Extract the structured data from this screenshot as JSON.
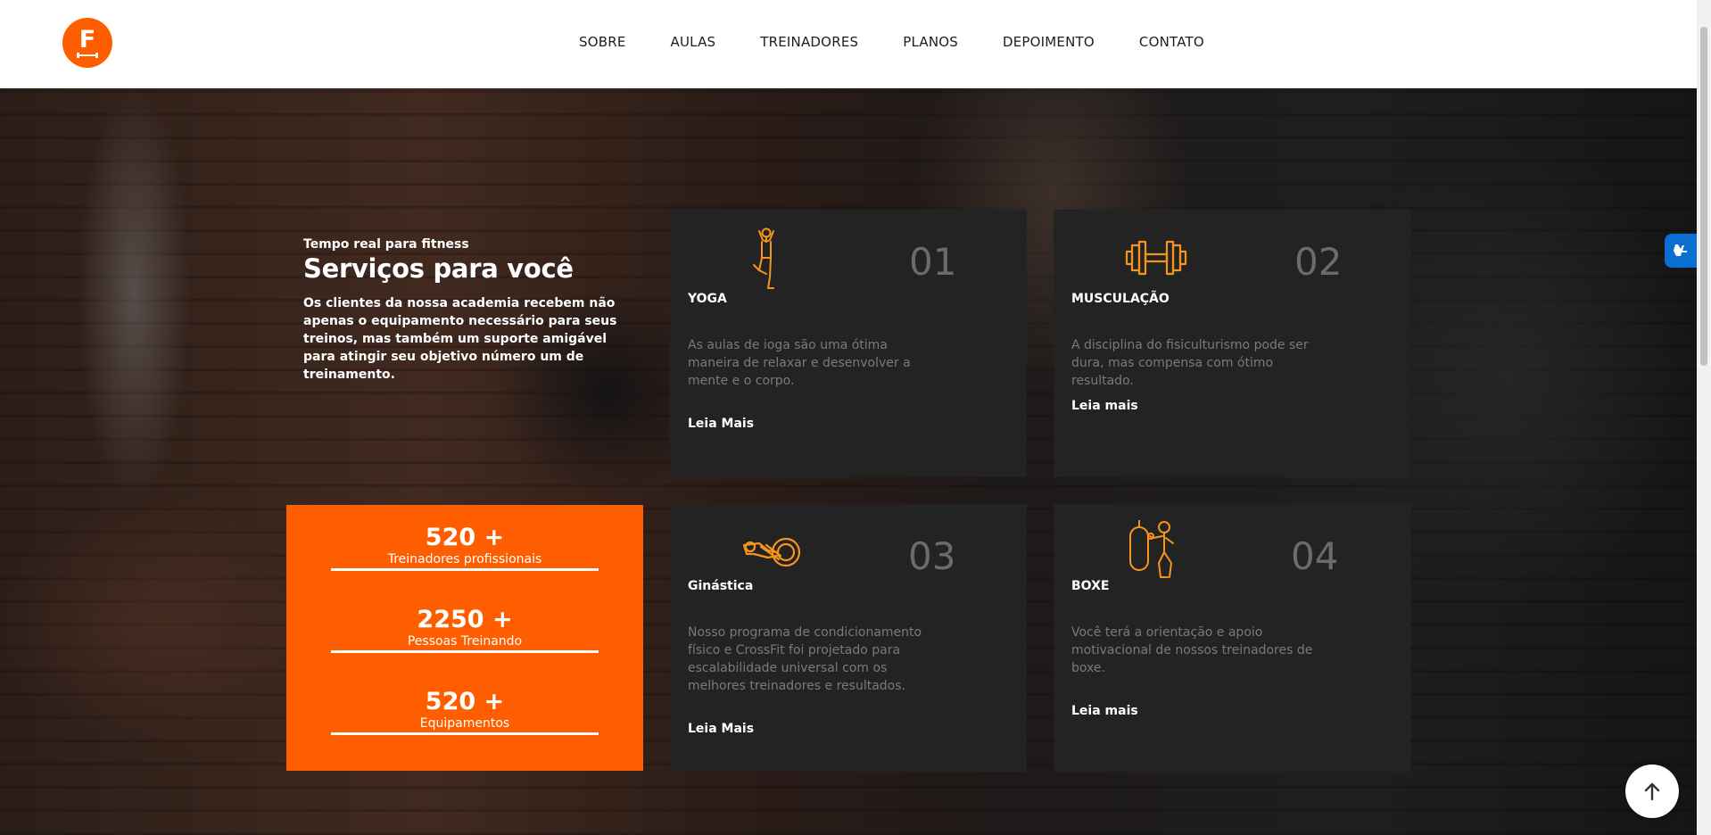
{
  "brand": {
    "logo_letter": "F",
    "accent": "#ff5e00"
  },
  "nav": {
    "items": [
      "SOBRE",
      "AULAS",
      "TREINADORES",
      "PLANOS",
      "DEPOIMENTO",
      "CONTATO"
    ]
  },
  "intro": {
    "kicker": "Tempo real para fitness",
    "title": "Serviços para você",
    "text": "Os clientes da nossa academia recebem não apenas o equipamento necessário para seus treinos, mas também um suporte amigável para atingir seu objetivo número um de treinamento."
  },
  "stats": [
    {
      "value": "520 +",
      "label": "Treinadores profissionais"
    },
    {
      "value": "2250 +",
      "label": "Pessoas Treinando"
    },
    {
      "value": "520 +",
      "label": "Equipamentos"
    }
  ],
  "services": [
    {
      "number": "01",
      "title": "YOGA",
      "icon": "yoga-icon",
      "description": "As aulas de ioga são uma ótima maneira de relaxar e desenvolver a mente e o corpo.",
      "link": "Leia Mais"
    },
    {
      "number": "02",
      "title": "MUSCULAÇÃO",
      "icon": "dumbbell-icon",
      "description": "A disciplina do fisiculturismo pode ser dura, mas compensa com ótimo resultado.",
      "link": "Leia mais"
    },
    {
      "number": "03",
      "title": "Ginástica",
      "icon": "stationary-bike-icon",
      "description": "Nosso programa de condicionamento físico e CrossFit foi projetado para escalabilidade universal com os melhores treinadores e resultados.",
      "link": "Leia Mais"
    },
    {
      "number": "04",
      "title": "BOXE",
      "icon": "boxing-icon",
      "description": "Você terá a orientação e apoio motivacional de nossos treinadores de boxe.",
      "link": "Leia mais"
    }
  ],
  "widgets": {
    "accessibility_icon": "sign-language-icon",
    "back_to_top_icon": "arrow-up-icon"
  }
}
